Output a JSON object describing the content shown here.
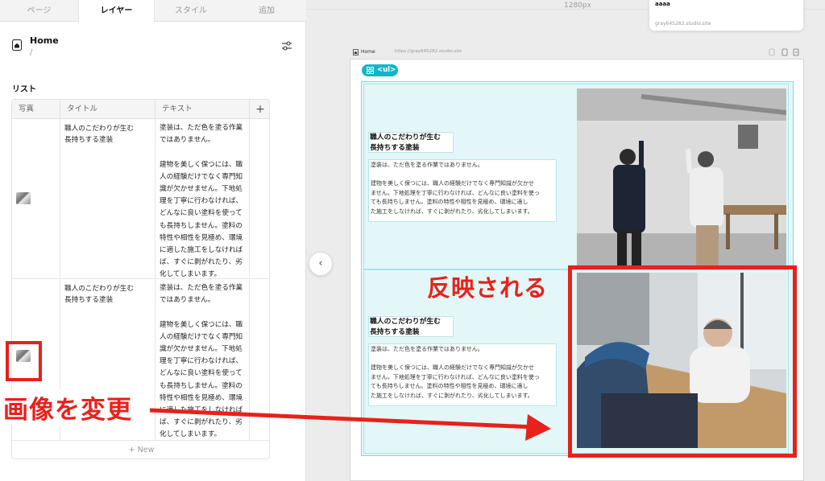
{
  "tabs": [
    {
      "label": "ページ"
    },
    {
      "label": "レイヤー"
    },
    {
      "label": "スタイル"
    },
    {
      "label": "追加"
    }
  ],
  "page": {
    "name": "Home",
    "path": "/"
  },
  "section_title": "リスト",
  "table": {
    "columns": [
      "写真",
      "タイトル",
      "テキスト"
    ],
    "add_column_label": "+",
    "rows": [
      {
        "title": "職人のこだわりが生む\n長持ちする塗装",
        "text": "塗装は、ただ色を塗る作業\nではありません。\n\n建物を美しく保つには、職\n人の経験だけでなく専門知\n識が欠かせません。下地処\n理を丁寧に行わなければ、\nどんなに良い塗料を使って\nも長持ちしません。塗料の\n特性や相性を見極め、環境\nに適した施工をしなければ\nば、すぐに剥がれたり、劣\n化してしまいます。"
      },
      {
        "title": "職人のこだわりが生む\n長持ちする塗装",
        "text": "塗装は、ただ色を塗る作業\nではありません。\n\n建物を美しく保つには、職\n人の経験だけでなく専門知\n識が欠かせません。下地処\n理を丁寧に行わなければ、\nどんなに良い塗料を使って\nも長持ちしません。塗料の\n特性や相性を見極め、環境\nに適した施工をしなければ\nば、すぐに剥がれたり、劣\n化してしまいます。"
      }
    ],
    "new_button": "+ New"
  },
  "canvas": {
    "width_label": "1280px",
    "site_name": "aaaa",
    "site_domain": "gray645282.studio.site",
    "bar_page": "Home",
    "bar_url": "https://gray645282.studio.site",
    "ul_badge": "<ul>",
    "items": [
      {
        "title": "職人のこだわりが生む\n長持ちする塗装",
        "text": "塗装は、ただ色を塗る作業ではありません。\n\n建物を美しく保つには、職人の経験だけでなく専門知識が欠かせ\nません。下地処理を丁寧に行わなければ、どんなに良い塗料を使っ\nても長持ちしません。塗料の特性や相性を見極め、環境に適し\nた施工をしなければ、すぐに剥がれたり、劣化してしまいます。"
      },
      {
        "title": "職人のこだわりが生む\n長持ちする塗装",
        "text": "塗装は、ただ色を塗る作業ではありません。\n\n建物を美しく保つには、職人の経験だけでなく専門知識が欠かせ\nません。下地処理を丁寧に行わなければ、どんなに良い塗料を使っ\nても長持ちしません。塗料の特性や相性を見極め、環境に適し\nた施工をしなければ、すぐに剥がれたり、劣化してしまいます。"
      }
    ]
  },
  "annotations": {
    "reflected": "反映される",
    "change_image": "画像を変更",
    "color": "#e8211b"
  },
  "colors": {
    "accent": "#13b6c6",
    "list_bg": "#e3f7f8"
  },
  "icons": [
    "home-icon",
    "settings-sliders-icon",
    "chevron-left-icon",
    "grid-icon",
    "arrow-right-icon"
  ]
}
